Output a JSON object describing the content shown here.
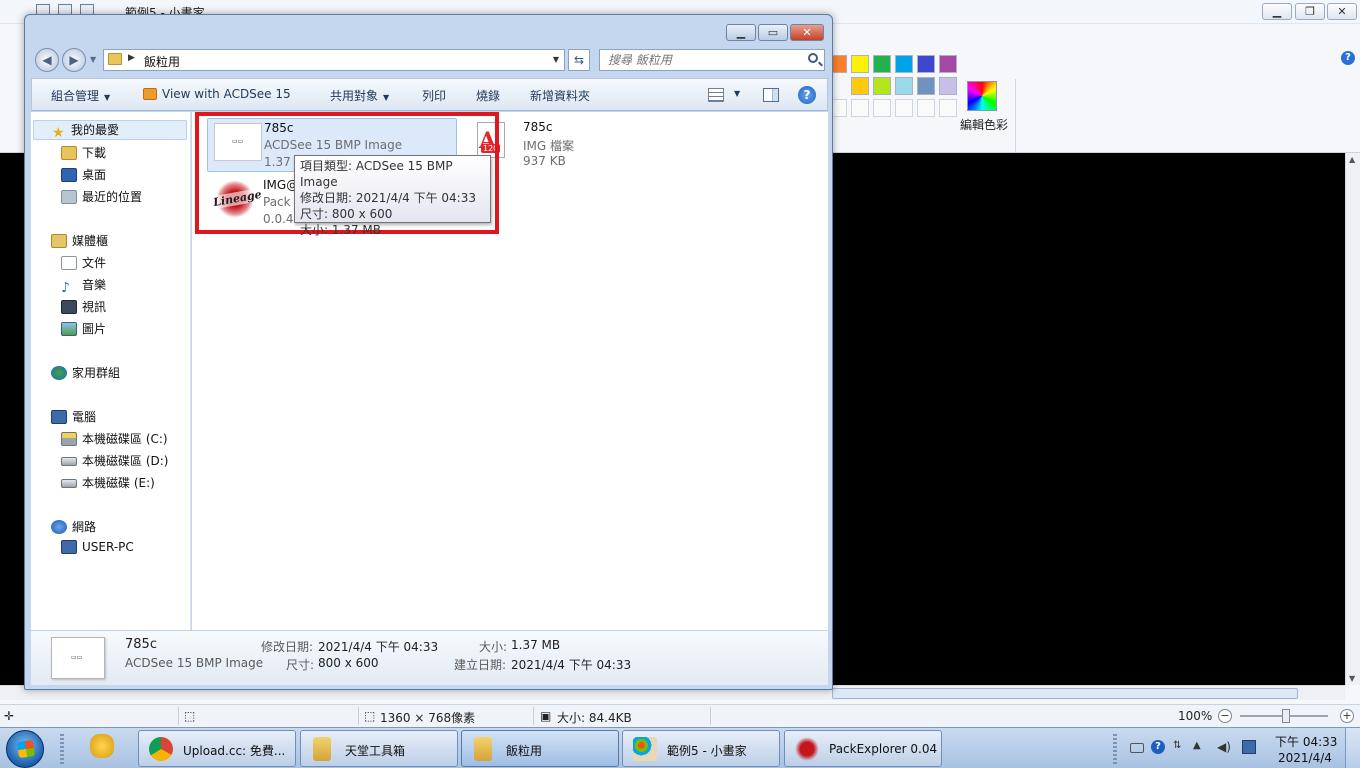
{
  "paint": {
    "title": "範例5 - 小畫家",
    "edit_colors_label": "編輯色彩",
    "status": {
      "dimensions": "1360 × 768像素",
      "size": "大小: 84.4KB",
      "zoom": "100%"
    },
    "palette_colors": [
      "#ff7f27",
      "#fff200",
      "#22b14c",
      "#00a2e8",
      "#3f48cc",
      "#a349a4",
      "#ffc90e",
      "#b5e61d",
      "#99d9ea",
      "#7092be",
      "#c8bfe7"
    ]
  },
  "explorer": {
    "address_text": "飯粒用",
    "search_placeholder": "搜尋 飯粒用",
    "toolbar": {
      "organize": "組合管理",
      "view_with_acdsee": "View with ACDSee 15",
      "share_with": "共用對象",
      "print": "列印",
      "burn": "燒錄",
      "new_folder": "新增資料夾"
    },
    "nav": {
      "favorites": "我的最愛",
      "downloads": "下載",
      "desktop": "桌面",
      "recent_places": "最近的位置",
      "libraries": "媒體櫃",
      "documents": "文件",
      "music": "音樂",
      "videos": "視訊",
      "pictures": "圖片",
      "homegroup": "家用群組",
      "computer": "電腦",
      "drive_c": "本機磁碟區 (C:)",
      "drive_d": "本機磁碟區 (D:)",
      "drive_e": "本機磁碟 (E:)",
      "network": "網路",
      "user_pc": "USER-PC"
    },
    "files": [
      {
        "name": "785c",
        "type": "ACDSee 15 BMP Image",
        "size": "1.37 MB"
      },
      {
        "name": "785c",
        "type": "IMG 檔案",
        "size": "937 KB"
      },
      {
        "name": "IMG@",
        "type": "Pack",
        "size": "0.0.4."
      }
    ],
    "tooltip": {
      "item_type": "項目類型: ACDSee 15 BMP Image",
      "modified": "修改日期: 2021/4/4 下午 04:33",
      "dimensions": "尺寸: 800 x 600",
      "size": "大小: 1.37 MB"
    },
    "details": {
      "name": "785c",
      "type": "ACDSee 15 BMP Image",
      "modified_label": "修改日期:",
      "modified_value": "2021/4/4 下午 04:33",
      "dimensions_label": "尺寸:",
      "dimensions_value": "800 x 600",
      "size_label": "大小:",
      "size_value": "1.37 MB",
      "created_label": "建立日期:",
      "created_value": "2021/4/4 下午 04:33"
    }
  },
  "taskbar": {
    "items": [
      {
        "label": "Upload.cc: 免費..."
      },
      {
        "label": "天堂工具箱"
      },
      {
        "label": "飯粒用"
      },
      {
        "label": "範例5 - 小畫家"
      },
      {
        "label": "PackExplorer 0.04"
      }
    ],
    "clock_time": "下午 04:33",
    "clock_date": "2021/4/4"
  }
}
